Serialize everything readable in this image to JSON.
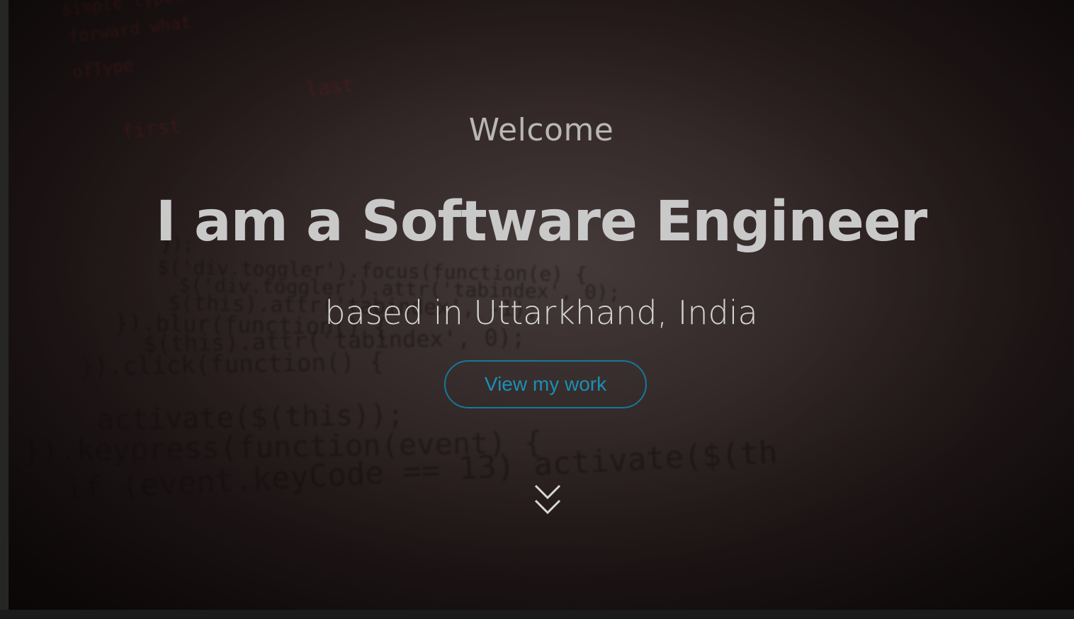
{
  "hero": {
    "welcome": "Welcome",
    "headline": "I am a Software Engineer",
    "subline": "based in Uttarkhand, India",
    "cta_label": "View my work",
    "scroll_icon": "double-chevron-down-icon"
  },
  "background_code": {
    "lines": [
      "simple   type.last   of-type",
      "forward   what",
      "ofType",
      "last",
      "first",
      "});",
      "$('div.toggler').focus(function(e) {",
      "$('div.toggler').attr('tabindex', 0);",
      "$(this).attr('tabindex', -1);",
      "}).blur(function() {",
      "$(this).attr('tabindex', 0);",
      "}).click(function() {",
      "activate($(this));",
      "}).keypress(function(event) {",
      "if (event.keyCode == 13) activate($(th"
    ]
  },
  "colors": {
    "accent": "#1a90b5",
    "headline": "#c9c9c9",
    "welcome": "#b8b6b6"
  }
}
